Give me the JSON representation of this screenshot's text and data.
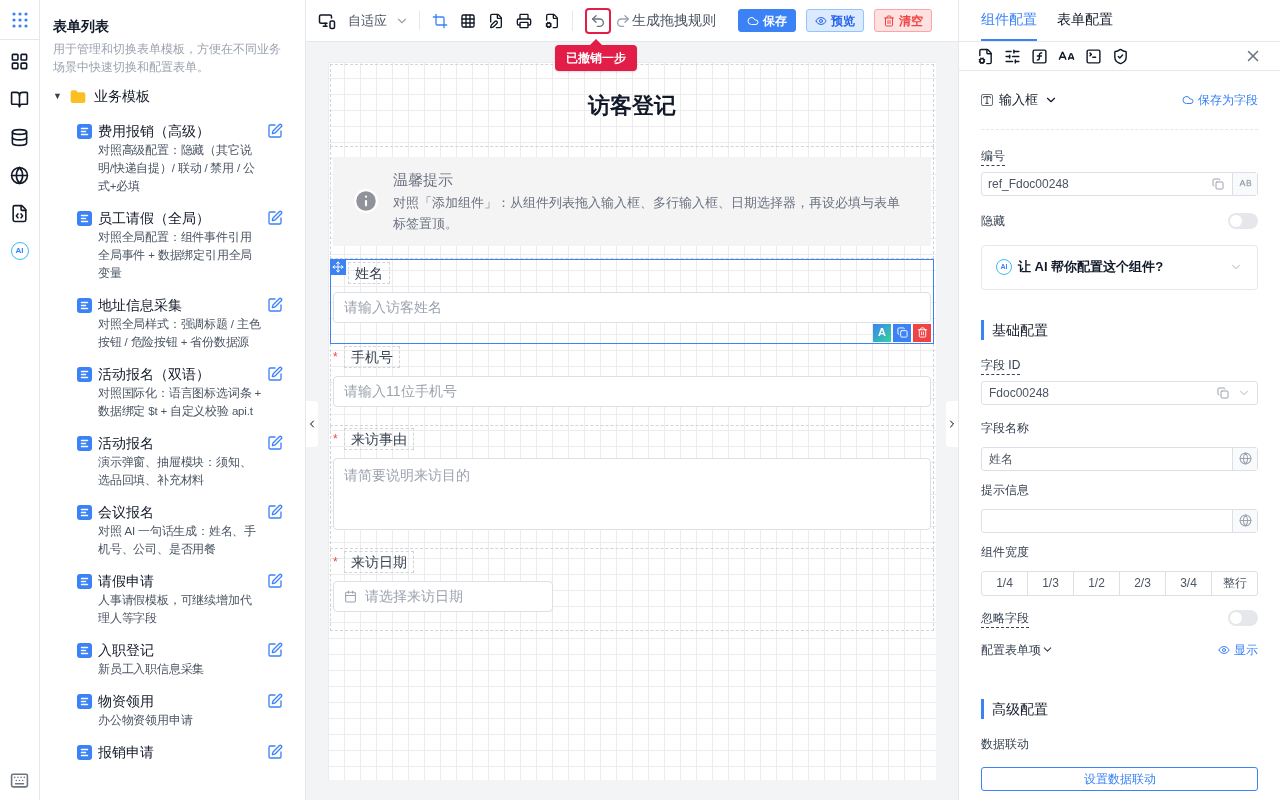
{
  "rail": {
    "ai_badge": "AI"
  },
  "sidebar": {
    "title": "表单列表",
    "description": "用于管理和切换表单模板，方便在不同业务场景中快速切换和配置表单。",
    "folder": {
      "caret": "▼",
      "label": "业务模板",
      "expanded": true,
      "items": [
        {
          "title": "费用报销（高级）",
          "description": "对照高级配置：隐藏（其它说明/快递自提）/ 联动 / 禁用 / 公式+必填"
        },
        {
          "title": "员工请假（全局）",
          "description": "对照全局配置：组件事件引用全局事件 + 数据绑定引用全局变量"
        },
        {
          "title": "地址信息采集",
          "description": "对照全局样式：强调标题 / 主色按钮 / 危险按钮 + 省份数据源"
        },
        {
          "title": "活动报名（双语）",
          "description": "对照国际化：语言图标选词条 + 数据绑定 $t + 自定义校验 api.t"
        },
        {
          "title": "活动报名",
          "description": "演示弹窗、抽屉模块：须知、选品回填、补充材料"
        },
        {
          "title": "会议报名",
          "description": "对照 AI 一句话生成：姓名、手机号、公司、是否用餐"
        },
        {
          "title": "请假申请",
          "description": "人事请假模板，可继续增加代理人等字段"
        },
        {
          "title": "入职登记",
          "description": "新员工入职信息采集"
        },
        {
          "title": "物资领用",
          "description": "办公物资领用申请"
        },
        {
          "title": "报销申请"
        }
      ]
    }
  },
  "toolbar": {
    "layout_select": "自适应",
    "redo_label": "生成拖拽规则",
    "undo_tooltip": "已撤销一步",
    "buttons": [
      {
        "kind": "primary",
        "label": "保存"
      },
      {
        "kind": "info",
        "label": "预览"
      },
      {
        "kind": "danger",
        "label": "清空"
      }
    ]
  },
  "canvas": {
    "title": "访客登记",
    "alert": {
      "title": "温馨提示",
      "text": "对照「添加组件」：从组件列表拖入输入框、多行输入框、日期选择器，再设必填与表单标签置顶。"
    },
    "field_actions": {
      "ai": "A"
    },
    "required_mark": "*",
    "fields": [
      {
        "label": "姓名",
        "required": false,
        "kind": "input",
        "placeholder": "请输入访客姓名",
        "selected": true
      },
      {
        "label": "手机号",
        "required": true,
        "kind": "input",
        "placeholder": "请输入11位手机号",
        "selected": false
      },
      {
        "label": "来访事由",
        "required": true,
        "kind": "textarea",
        "placeholder": "请简要说明来访目的",
        "selected": false
      },
      {
        "label": "来访日期",
        "required": true,
        "kind": "date",
        "placeholder": "请选择来访日期",
        "selected": false
      }
    ]
  },
  "config": {
    "tabs": [
      {
        "label": "组件配置",
        "selected": true
      },
      {
        "label": "表单配置",
        "selected": false
      }
    ],
    "component_type": "输入框",
    "save_as_field": "保存为字段",
    "ref": {
      "label": "编号",
      "value": "ref_Fdoc00248"
    },
    "hidden": {
      "label": "隐藏",
      "on": false
    },
    "ai_helper": {
      "badge": "AI",
      "text": "让 AI 帮你配置这个组件?"
    },
    "basic": {
      "title": "基础配置",
      "field_id": {
        "label": "字段 ID",
        "value": "Fdoc00248"
      },
      "field_name": {
        "label": "字段名称",
        "value": "姓名"
      },
      "hint": {
        "label": "提示信息"
      },
      "width": {
        "label": "组件宽度",
        "options": [
          {
            "label": "1/4",
            "selected": false
          },
          {
            "label": "1/3",
            "selected": false
          },
          {
            "label": "1/2",
            "selected": false
          },
          {
            "label": "2/3",
            "selected": false
          },
          {
            "label": "3/4",
            "selected": false
          },
          {
            "label": "整行",
            "selected": false
          }
        ]
      },
      "ignore": {
        "label": "忽略字段",
        "on": false
      },
      "form_items": {
        "label": "配置表单项",
        "action": "显示"
      }
    },
    "advanced": {
      "title": "高级配置",
      "data_link_label": "数据联动",
      "data_link_button": "设置数据联动"
    }
  }
}
